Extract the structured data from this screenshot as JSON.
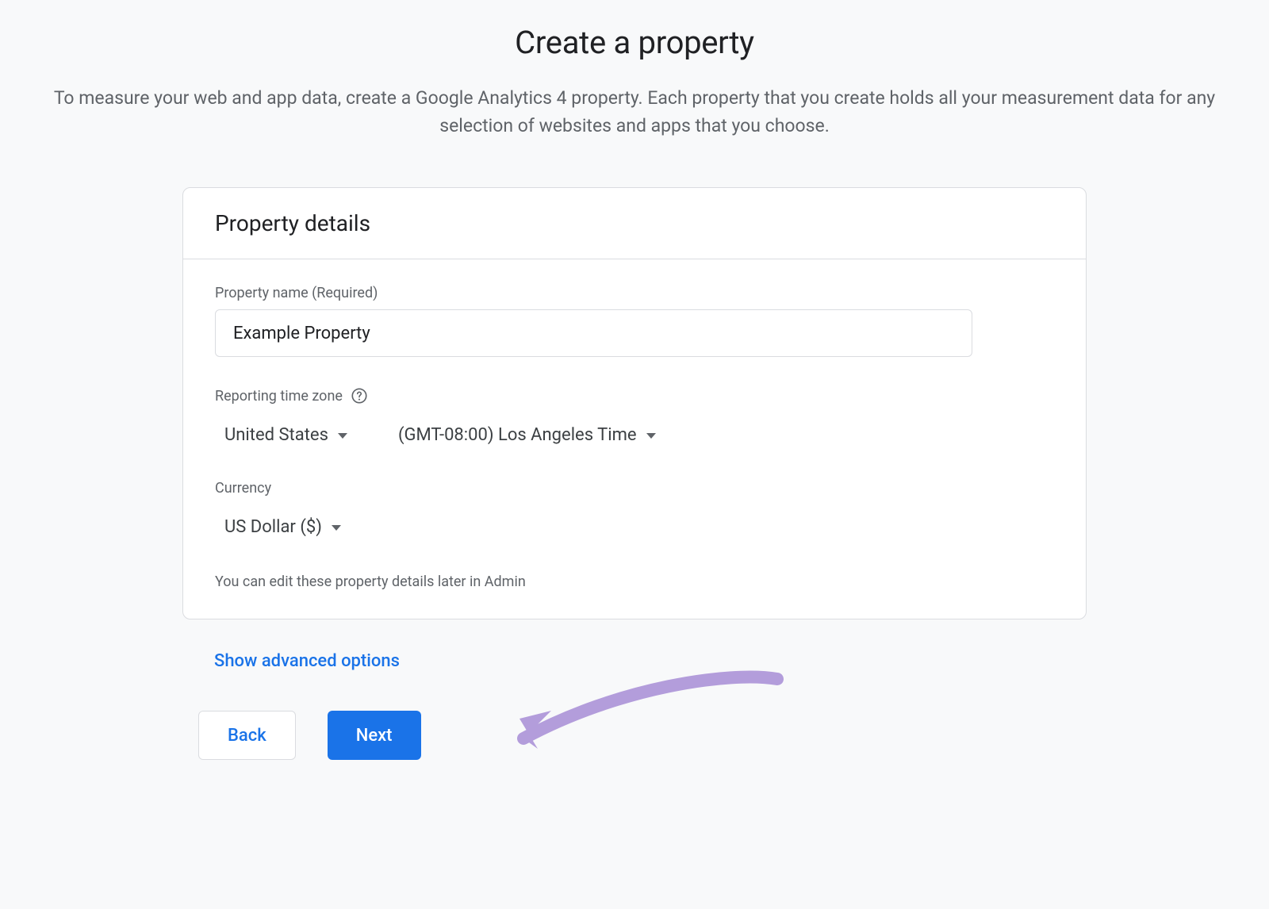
{
  "page": {
    "title": "Create a property",
    "subtitle": "To measure your web and app data, create a Google Analytics 4 property. Each property that you create holds all your measurement data for any selection of websites and apps that you choose."
  },
  "card": {
    "header_title": "Property details",
    "property_name": {
      "label": "Property name (Required)",
      "value": "Example Property"
    },
    "timezone": {
      "label": "Reporting time zone",
      "country_value": "United States",
      "tz_value": "(GMT-08:00) Los Angeles Time"
    },
    "currency": {
      "label": "Currency",
      "value": "US Dollar ($)"
    },
    "hint": "You can edit these property details later in Admin"
  },
  "advanced_link": "Show advanced options",
  "buttons": {
    "back": "Back",
    "next": "Next"
  }
}
